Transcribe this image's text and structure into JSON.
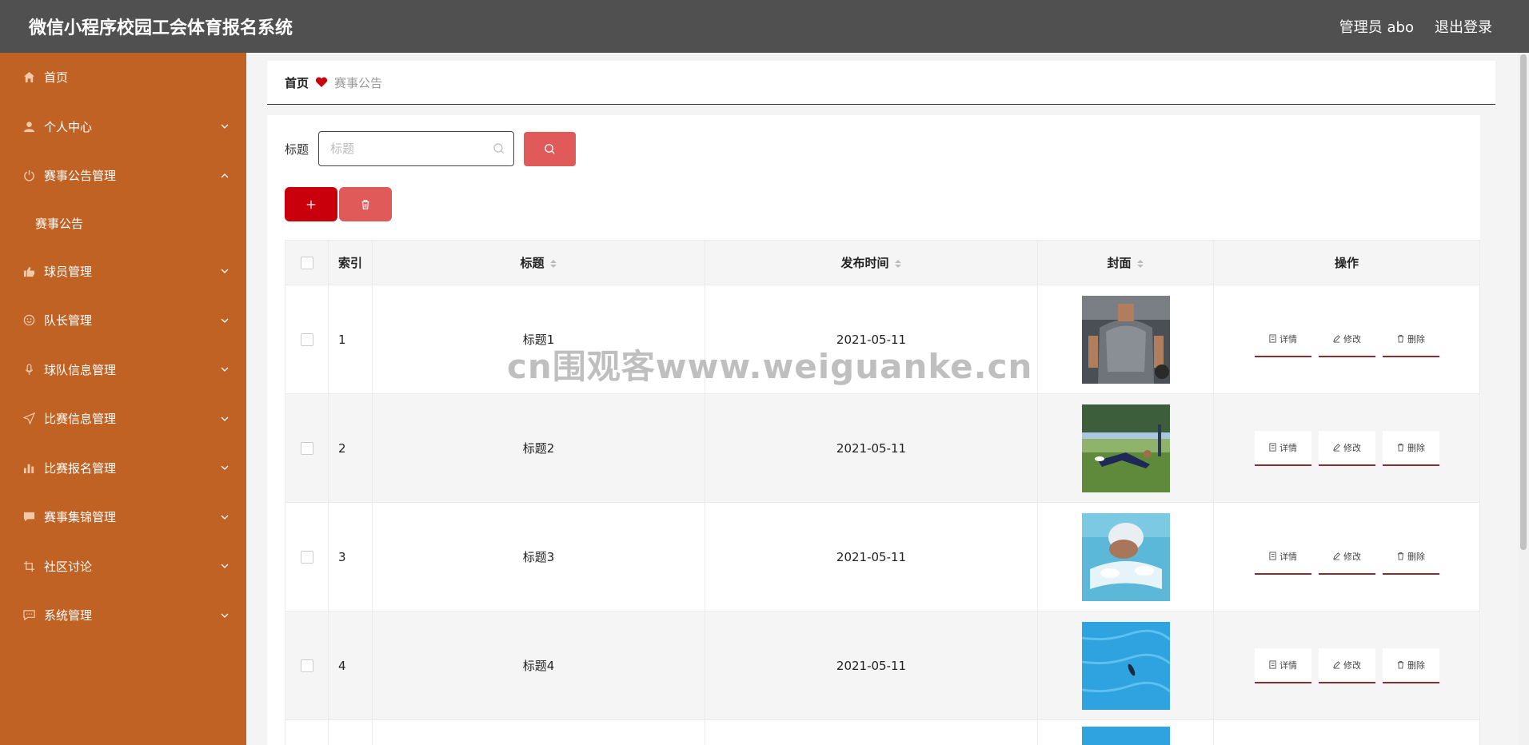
{
  "header": {
    "title": "微信小程序校园工会体育报名系统",
    "user_label": "管理员 abo",
    "logout_label": "退出登录"
  },
  "sidebar": {
    "items": [
      {
        "label": "首页",
        "icon": "home-icon"
      },
      {
        "label": "个人中心",
        "icon": "user-icon"
      },
      {
        "label": "赛事公告管理",
        "icon": "power-icon"
      },
      {
        "label": "球员管理",
        "icon": "thumb-icon"
      },
      {
        "label": "队长管理",
        "icon": "smile-icon"
      },
      {
        "label": "球队信息管理",
        "icon": "mic-icon"
      },
      {
        "label": "比赛信息管理",
        "icon": "send-icon"
      },
      {
        "label": "比赛报名管理",
        "icon": "bar-chart-icon"
      },
      {
        "label": "赛事集锦管理",
        "icon": "chat-icon"
      },
      {
        "label": "社区讨论",
        "icon": "crop-icon"
      },
      {
        "label": "系统管理",
        "icon": "message-icon"
      }
    ],
    "submenu": {
      "label": "赛事公告"
    }
  },
  "breadcrumb": {
    "home": "首页",
    "current": "赛事公告"
  },
  "search": {
    "label": "标题",
    "placeholder": "标题"
  },
  "table": {
    "headers": {
      "index": "索引",
      "title": "标题",
      "time": "发布时间",
      "cover": "封面",
      "ops": "操作"
    },
    "rows": [
      {
        "index": "1",
        "title": "标题1",
        "time": "2021-05-11",
        "cover": "gym-photo"
      },
      {
        "index": "2",
        "title": "标题2",
        "time": "2021-05-11",
        "cover": "field-photo"
      },
      {
        "index": "3",
        "title": "标题3",
        "time": "2021-05-11",
        "cover": "swimmer-photo"
      },
      {
        "index": "4",
        "title": "标题4",
        "time": "2021-05-11",
        "cover": "pool-photo"
      }
    ],
    "ops": {
      "detail": "详情",
      "edit": "修改",
      "delete": "删除"
    }
  },
  "watermark": "cn围观客www.weiguanke.cn",
  "colors": {
    "header": "#505050",
    "sidebar": "#c16225",
    "accent": "#c9000b",
    "accent_light": "#e05a59"
  }
}
